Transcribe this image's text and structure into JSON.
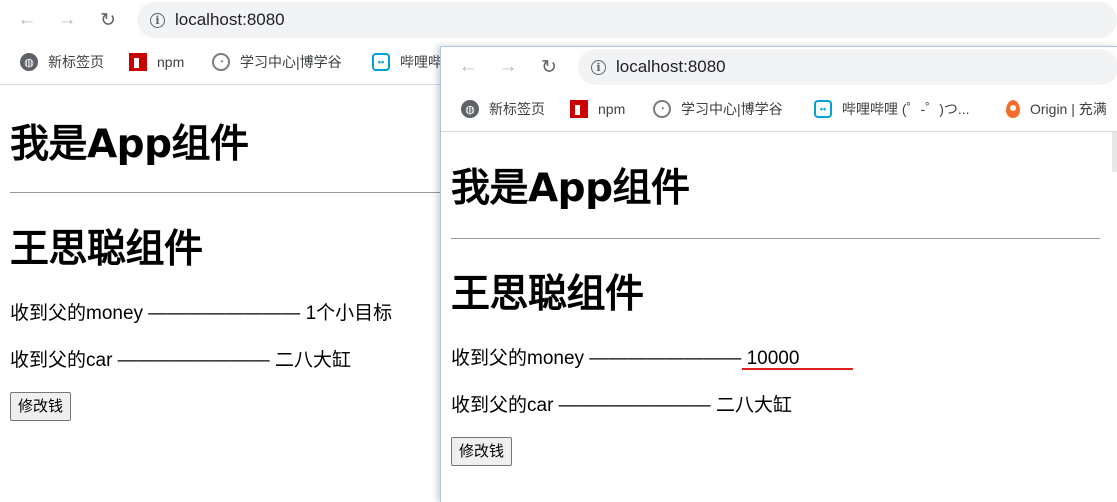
{
  "back_window": {
    "url": "localhost:8080",
    "bookmarks": [
      "新标签页",
      "npm",
      "学习中心|博学谷",
      "哔哩哔"
    ],
    "app_heading": "我是App组件",
    "component_heading": "王思聪组件",
    "money_line": "收到父的money ———————— 1个小目标",
    "car_line": "收到父的car ———————— 二八大缸",
    "button_label": "修改钱"
  },
  "front_window": {
    "url": "localhost:8080",
    "bookmarks": [
      "新标签页",
      "npm",
      "学习中心|博学谷",
      "哔哩哔哩 (゜-゜)つ...",
      "Origin | 充满"
    ],
    "app_heading": "我是App组件",
    "component_heading": "王思聪组件",
    "money_label": "收到父的money ————————",
    "money_value": "10000",
    "car_line": "收到父的car ———————— 二八大缸",
    "button_label": "修改钱",
    "highlight_color": "#e02020"
  },
  "icons": {
    "back": "arrow-left-icon",
    "forward": "arrow-right-icon",
    "reload": "reload-icon",
    "info": "info-icon"
  }
}
